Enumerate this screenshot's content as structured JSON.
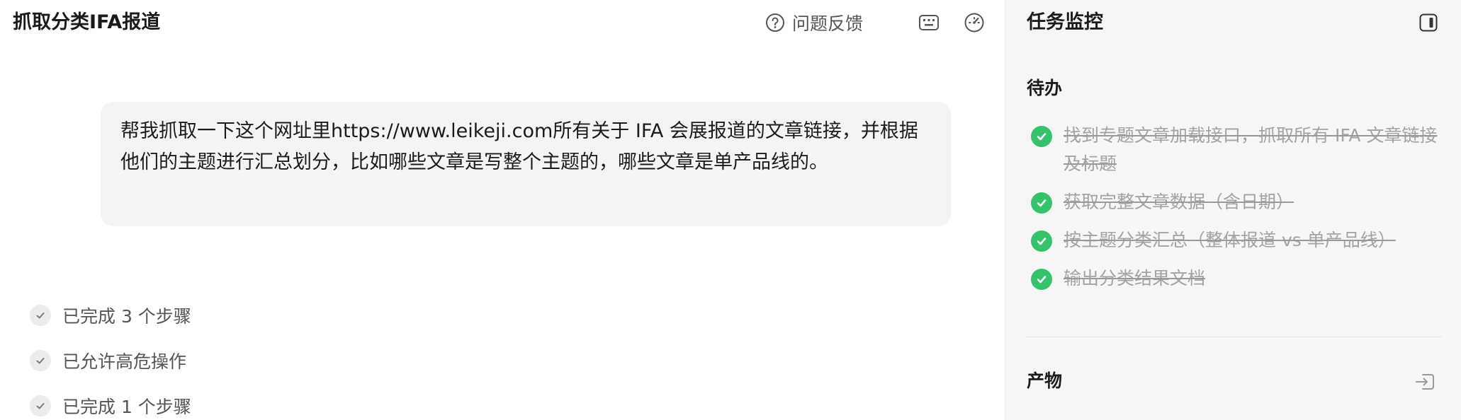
{
  "header": {
    "title": "抓取分类IFA报道",
    "feedback_label": "问题反馈"
  },
  "message": {
    "text": "帮我抓取一下这个网址里https://www.leikeji.com所有关于 IFA 会展报道的文章链接，并根据他们的主题进行汇总划分，比如哪些文章是写整个主题的，哪些文章是单产品线的。"
  },
  "steps": [
    {
      "label": "已完成 3 个步骤"
    },
    {
      "label": "已允许高危操作"
    },
    {
      "label": "已完成 1 个步骤"
    }
  ],
  "side": {
    "title": "任务监控",
    "todo_heading": "待办",
    "todos": [
      {
        "label": "找到专题文章加载接口，抓取所有 IFA 文章链接及标题"
      },
      {
        "label": "获取完整文章数据（含日期）"
      },
      {
        "label": "按主题分类汇总（整体报道 vs 单产品线）"
      },
      {
        "label": "输出分类结果文档"
      }
    ],
    "artifact_heading": "产物"
  },
  "colors": {
    "done_green": "#34c26a",
    "panel_bg": "#f6f6f6",
    "bubble_bg": "#f4f4f4"
  },
  "icons": {
    "feedback": "question-circle-icon",
    "keyboard": "keyboard-icon",
    "gauge": "gauge-icon",
    "collapse": "panel-toggle-icon",
    "export": "export-icon",
    "check": "check-icon"
  }
}
